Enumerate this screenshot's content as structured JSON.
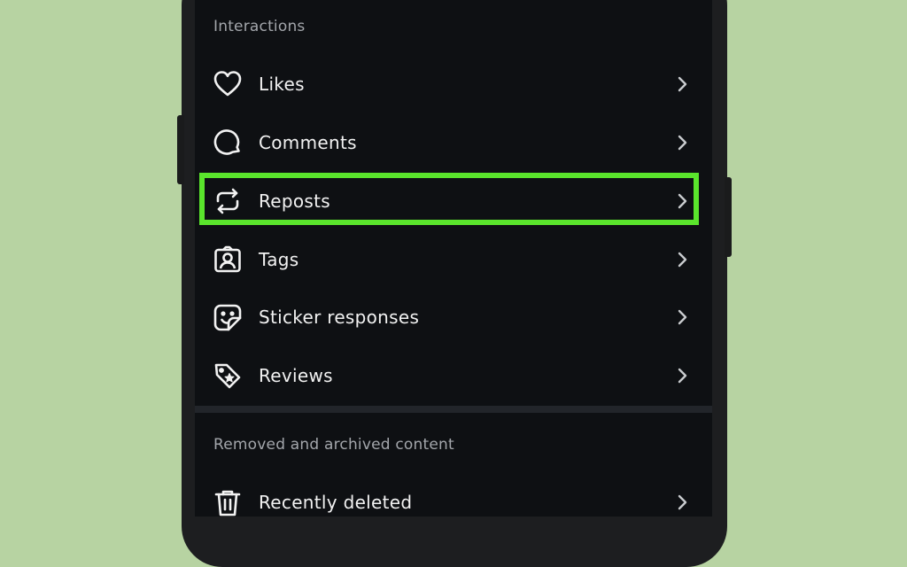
{
  "interactions": {
    "header": "Interactions",
    "items": [
      {
        "label": "Likes",
        "icon": "heart-icon"
      },
      {
        "label": "Comments",
        "icon": "comment-icon"
      },
      {
        "label": "Reposts",
        "icon": "repost-icon",
        "highlighted": true
      },
      {
        "label": "Tags",
        "icon": "tag-person-icon"
      },
      {
        "label": "Sticker responses",
        "icon": "sticker-icon"
      },
      {
        "label": "Reviews",
        "icon": "review-tag-icon"
      }
    ]
  },
  "removed_archived": {
    "header": "Removed and archived content",
    "items": [
      {
        "label": "Recently deleted",
        "icon": "trash-icon"
      }
    ]
  },
  "colors": {
    "background": "#b7d3a2",
    "screen": "#0e1013",
    "highlight": "#5ae52c",
    "text": "#f2f2f2",
    "muted_text": "#a3a6ab"
  }
}
